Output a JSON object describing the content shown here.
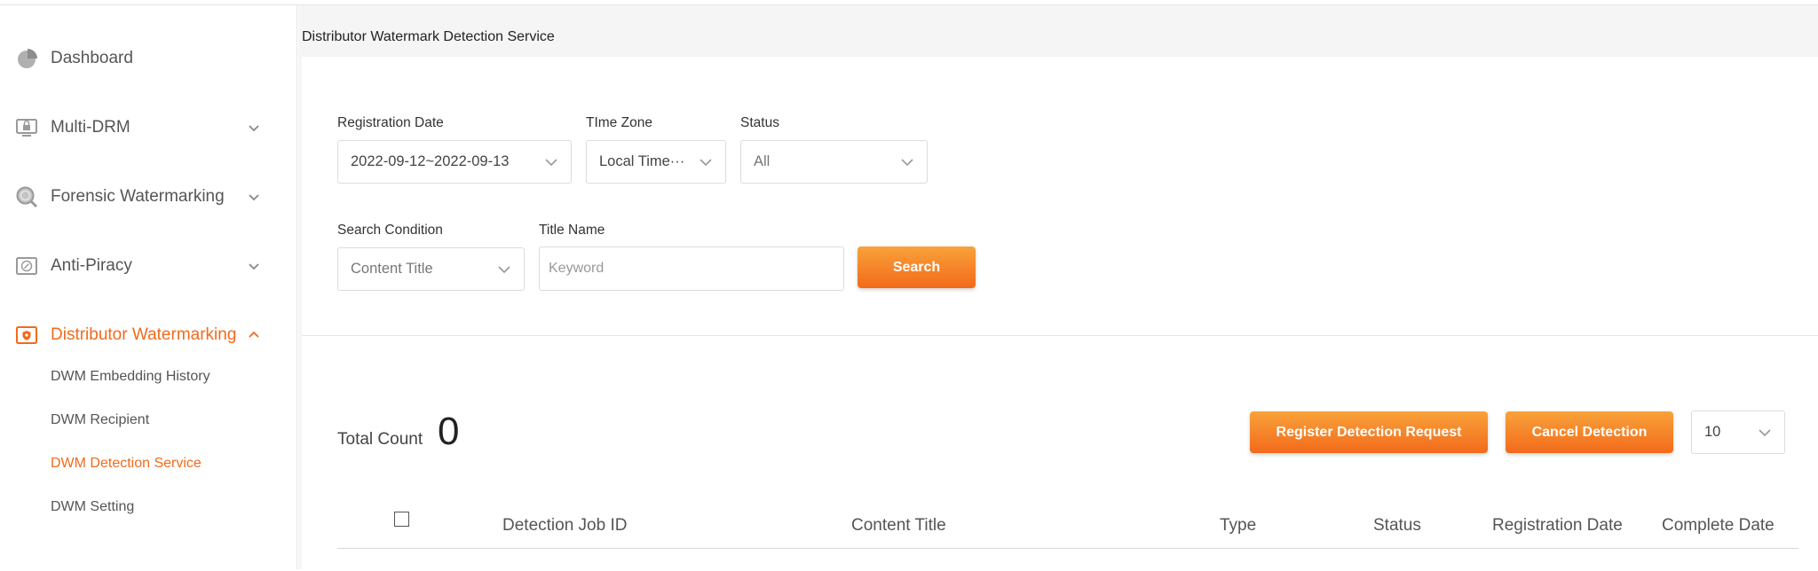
{
  "sidebar": {
    "items": [
      {
        "label": "Dashboard",
        "icon": "pie-chart-icon",
        "expandable": false
      },
      {
        "label": "Multi-DRM",
        "icon": "monitor-lock-icon",
        "expandable": true
      },
      {
        "label": "Forensic Watermarking",
        "icon": "magnifier-icon",
        "expandable": true
      },
      {
        "label": "Anti-Piracy",
        "icon": "compass-frame-icon",
        "expandable": true
      },
      {
        "label": "Distributor Watermarking",
        "icon": "shield-frame-icon",
        "expandable": true,
        "expanded": true,
        "active": true
      }
    ],
    "subitems": [
      {
        "label": "DWM Embedding History",
        "active": false
      },
      {
        "label": "DWM Recipient",
        "active": false
      },
      {
        "label": "DWM Detection Service",
        "active": true
      },
      {
        "label": "DWM Setting",
        "active": false
      }
    ]
  },
  "main": {
    "page_title": "Distributor Watermark Detection Service",
    "filters": {
      "registration_date_label": "Registration Date",
      "registration_date_value": "2022-09-12~2022-09-13",
      "time_zone_label": "TIme Zone",
      "time_zone_value": "Local Time···",
      "status_label": "Status",
      "status_value": "All",
      "search_condition_label": "Search Condition",
      "search_condition_value": "Content Title",
      "title_name_label": "Title Name",
      "title_name_placeholder": "Keyword",
      "search_button": "Search"
    },
    "results": {
      "total_count_label": "Total Count",
      "total_count_value": "0",
      "register_button": "Register Detection Request",
      "cancel_button": "Cancel Detection",
      "page_size": "10",
      "columns": [
        "Detection Job ID",
        "Content Title",
        "Type",
        "Status",
        "Registration Date",
        "Complete Date"
      ]
    }
  },
  "colors": {
    "accent": "#f26a1b",
    "button_gradient_top": "#f9a23a",
    "button_gradient_bottom": "#f26a1b",
    "background": "#f5f5f5"
  }
}
